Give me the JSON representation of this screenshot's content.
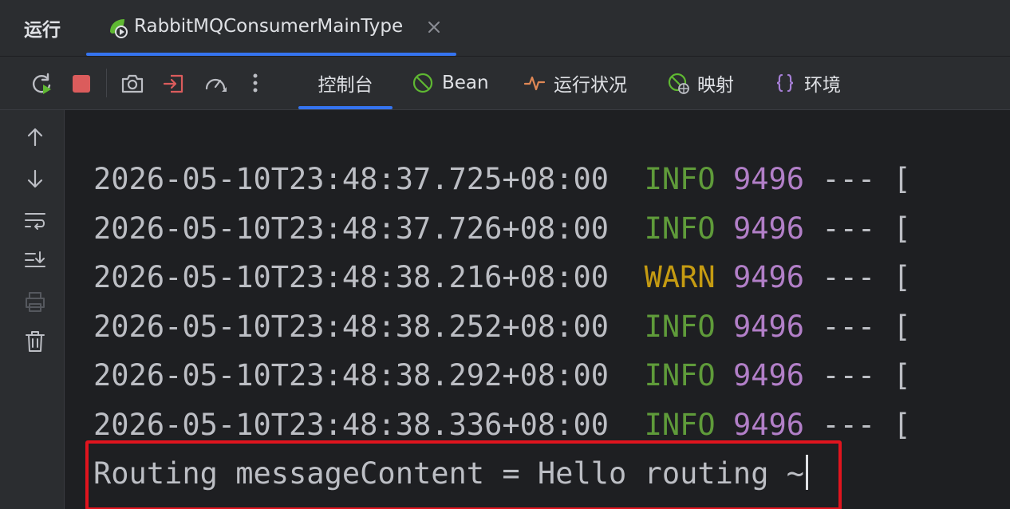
{
  "run_header": {
    "title": "运行",
    "config_tab_label": "RabbitMQConsumerMainType"
  },
  "toolbar": {
    "tabs": [
      {
        "label": "控制台",
        "icon": "console",
        "active": true
      },
      {
        "label": "Bean",
        "icon": "bean-icon"
      },
      {
        "label": "运行状况",
        "icon": "health-pulse-icon"
      },
      {
        "label": "映射",
        "icon": "mappings-icon"
      },
      {
        "label": "环境",
        "icon": "braces-icon"
      }
    ]
  },
  "console": {
    "lines": [
      {
        "timestamp": "2026-05-10T23:48:37.725+08:00",
        "level": "INFO",
        "pid": "9496",
        "rest": " --- ["
      },
      {
        "timestamp": "2026-05-10T23:48:37.726+08:00",
        "level": "INFO",
        "pid": "9496",
        "rest": " --- ["
      },
      {
        "timestamp": "2026-05-10T23:48:38.216+08:00",
        "level": "WARN",
        "pid": "9496",
        "rest": " --- ["
      },
      {
        "timestamp": "2026-05-10T23:48:38.252+08:00",
        "level": "INFO",
        "pid": "9496",
        "rest": " --- ["
      },
      {
        "timestamp": "2026-05-10T23:48:38.292+08:00",
        "level": "INFO",
        "pid": "9496",
        "rest": " --- ["
      },
      {
        "timestamp": "2026-05-10T23:48:38.336+08:00",
        "level": "INFO",
        "pid": "9496",
        "rest": " --- ["
      }
    ],
    "output_line": "Routing messageContent = Hello routing ~"
  },
  "colors": {
    "info": "#5f9b3a",
    "warn": "#c59b12",
    "pid": "#b27fc8",
    "accent": "#3574f0",
    "highlight": "#e0141e",
    "stop": "#db5c5c"
  }
}
